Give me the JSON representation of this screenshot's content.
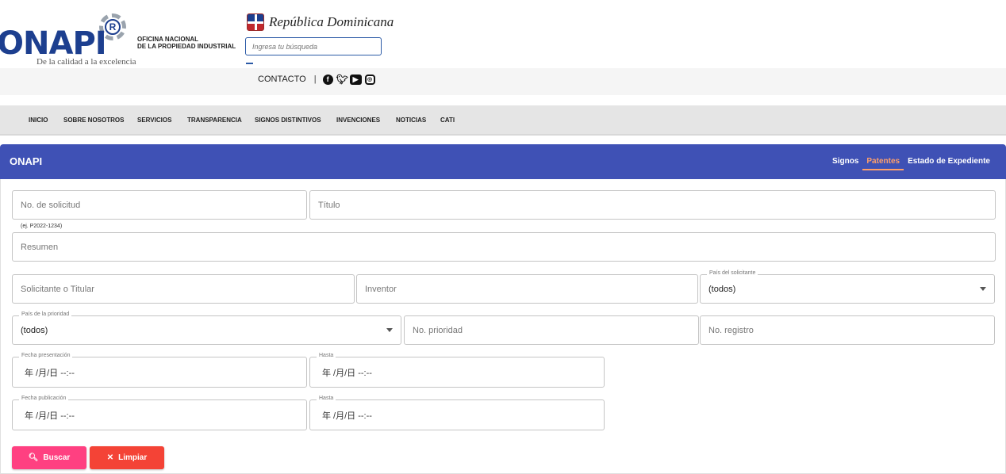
{
  "header": {
    "logo_text": "ONAPI",
    "logo_reg": "R",
    "tagline": "De la calidad a la excelencia",
    "org_name_line1": "OFICINA NACIONAL",
    "org_name_line2": "DE LA PROPIEDAD INDUSTRIAL",
    "country_brand": "República Dominicana",
    "search_placeholder": "Ingresa tu búsqueda"
  },
  "contact": {
    "label": "CONTACTO",
    "separator": "|",
    "social": [
      "facebook-icon",
      "twitter-icon",
      "youtube-icon",
      "instagram-icon"
    ]
  },
  "nav": {
    "items": [
      "INICIO",
      "SOBRE NOSOTROS",
      "SERVICIOS",
      "TRANSPARENCIA",
      "SIGNOS DISTINTIVOS",
      "INVENCIONES",
      "NOTICIAS",
      "CATI"
    ]
  },
  "app_bar": {
    "title": "ONAPI",
    "tabs": [
      "Signos",
      "Patentes",
      "Estado de Expediente"
    ],
    "active_tab": "Patentes",
    "color": "#3f51b5",
    "active_color": "#ff9f6b"
  },
  "form": {
    "solicitud_placeholder": "No. de solicitud",
    "solicitud_hint": "(ej. P2022-1234)",
    "titulo_placeholder": "Título",
    "resumen_placeholder": "Resumen",
    "solicitante_placeholder": "Solicitante o Titular",
    "inventor_placeholder": "Inventor",
    "pais_solicitante_label": "País del solicitante",
    "pais_solicitante_value": "(todos)",
    "pais_prioridad_label": "País de la prioridad",
    "pais_prioridad_value": "(todos)",
    "no_prioridad_placeholder": "No. prioridad",
    "no_registro_placeholder": "No. registro",
    "fecha_presentacion_label": "Fecha presentación",
    "fecha_presentacion_value": "年 /月/日 --:--",
    "hasta1_label": "Hasta",
    "hasta1_value": "年 /月/日 --:--",
    "fecha_publicacion_label": "Fecha publicación",
    "fecha_publicacion_value": "年 /月/日 --:--",
    "hasta2_label": "Hasta",
    "hasta2_value": "年 /月/日 --:--"
  },
  "buttons": {
    "buscar": "Buscar",
    "limpiar": "Limpiar",
    "buscar_color": "#ff4081",
    "limpiar_color": "#f44336"
  }
}
